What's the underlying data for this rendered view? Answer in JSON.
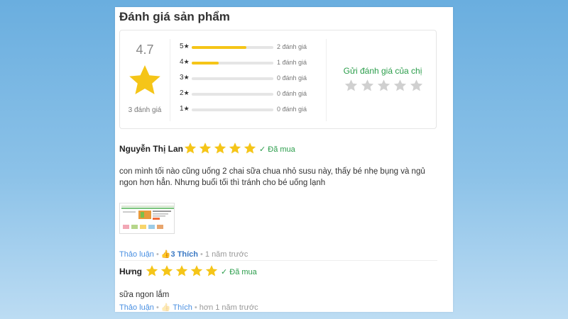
{
  "section": {
    "title": "Đánh giá sản phẩm"
  },
  "summary": {
    "average": "4.7",
    "count_label": "3 đánh giá",
    "bars": [
      {
        "label": "5",
        "fraction": 0.67,
        "count": "2 đánh giá"
      },
      {
        "label": "4",
        "fraction": 0.33,
        "count": "1 đánh giá"
      },
      {
        "label": "3",
        "fraction": 0.0,
        "count": "0 đánh giá"
      },
      {
        "label": "2",
        "fraction": 0.0,
        "count": "0 đánh giá"
      },
      {
        "label": "1",
        "fraction": 0.0,
        "count": "0 đánh giá"
      }
    ],
    "send_label": "Gửi đánh giá của chị",
    "send_stars": 5
  },
  "reviews": [
    {
      "name": "Nguyễn Thị Lan",
      "stars": 5,
      "bought": "Đã mua",
      "text": "con mình tối nào cũng uống 2 chai sữa chua nhỏ susu này, thấy bé nhẹ bụng và ngủ ngon hơn hẳn. Nhưng buổi tối thì tránh cho bé uống lạnh",
      "discuss": "Thảo luận",
      "like_count": "3",
      "like": "Thích",
      "time": "1 năm trước"
    },
    {
      "name": "Hưng",
      "stars": 5,
      "bought": "Đã mua",
      "text": "sữa ngon lắm",
      "discuss": "Thảo luận",
      "like": "Thích",
      "time": "hơn 1 năm trước"
    }
  ],
  "colors": {
    "star": "#f5c518",
    "star_empty": "#d0d0d0",
    "green": "#2a9d4a",
    "link": "#4a90e2"
  },
  "icons": {
    "rating_star": "star-icon",
    "bought_check": "check-icon",
    "like": "thumbs-up-icon"
  }
}
